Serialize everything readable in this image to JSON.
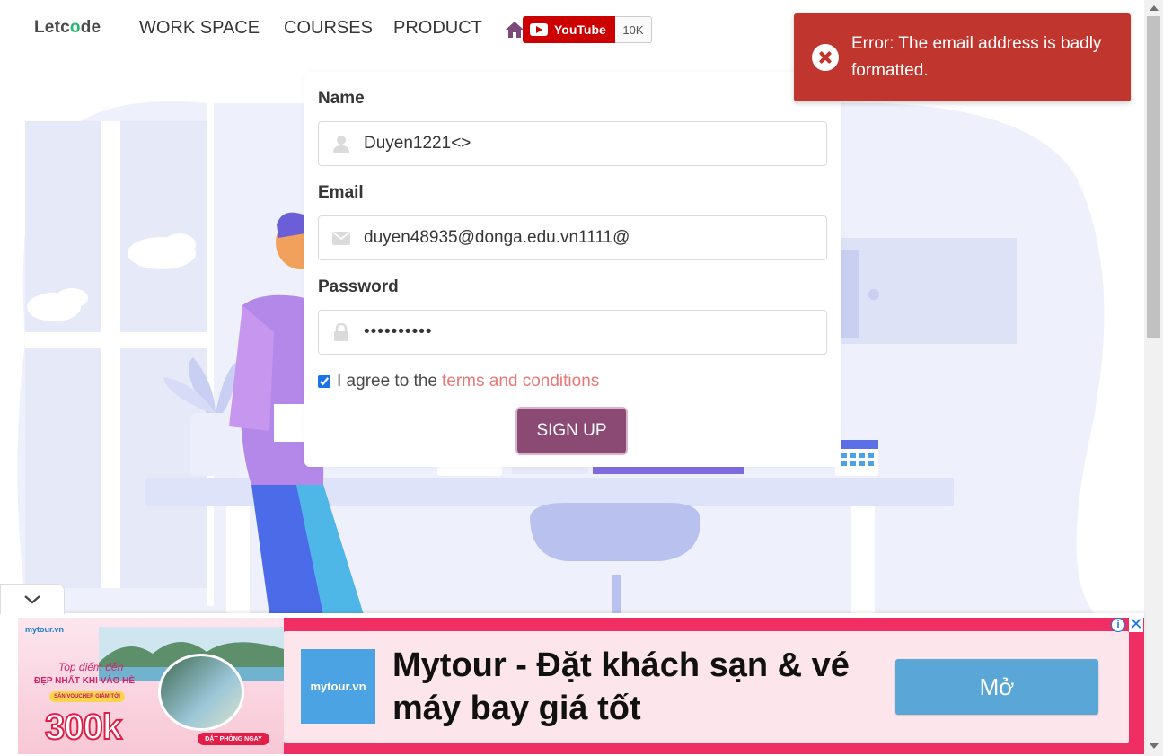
{
  "nav": {
    "logo_prefix": "Letc",
    "logo_o": "o",
    "logo_suffix": "de",
    "links": [
      "WORK SPACE",
      "COURSES",
      "PRODUCT"
    ],
    "youtube_label": "YouTube",
    "youtube_count": "10K"
  },
  "form": {
    "name_label": "Name",
    "name_value": "Duyen1221<>",
    "email_label": "Email",
    "email_value": "duyen48935@donga.edu.vn1111@",
    "password_label": "Password",
    "password_value": "••••••••••",
    "agree_checked": true,
    "agree_text": "I agree to the",
    "terms_link": "terms and conditions",
    "signup_label": "SIGN UP"
  },
  "toast": {
    "message": "Error: The email address is badly formatted.",
    "color": "#c0352d"
  },
  "ad": {
    "brand_small": "mytour.vn",
    "tagline1": "Top điểm đến",
    "tagline2": "ĐẸP NHẤT KHI VÀO HÈ",
    "voucher": "SĂN VOUCHER GIẢM TỚI",
    "amount": "300k",
    "book": "ĐẶT PHÒNG NGAY",
    "logo_text": "mytour.vn",
    "headline": "Mytour - Đặt khách sạn & vé máy bay giá tốt",
    "cta": "Mở",
    "accent": "#ef2f64"
  },
  "colors": {
    "primary_button": "#8b4a74",
    "terms_link": "#e87878",
    "illustration_tint": "#eef0fb"
  }
}
